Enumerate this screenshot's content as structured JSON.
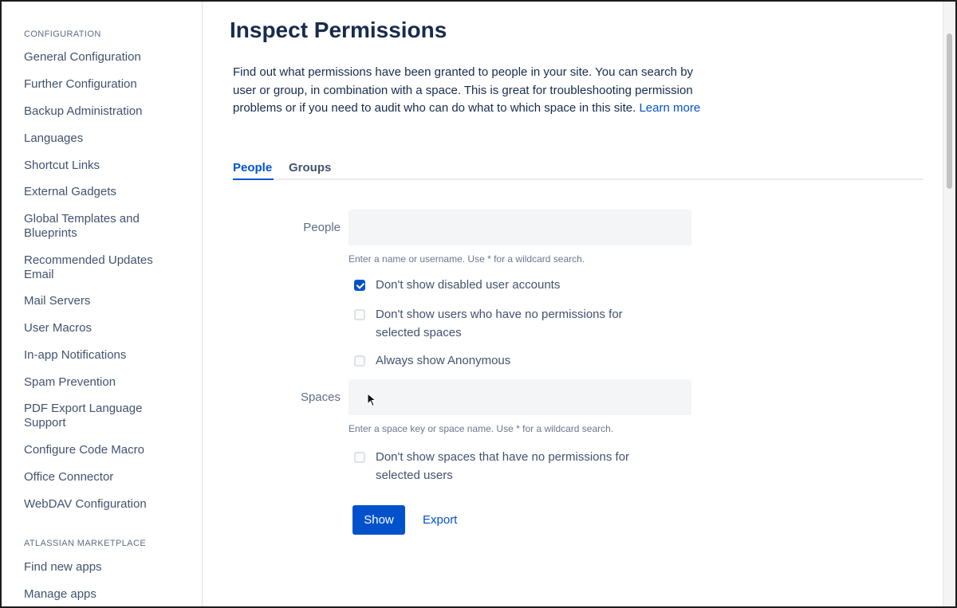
{
  "sidebar": {
    "configuration_heading": "CONFIGURATION",
    "items": [
      {
        "label": "General Configuration"
      },
      {
        "label": "Further Configuration"
      },
      {
        "label": "Backup Administration"
      },
      {
        "label": "Languages"
      },
      {
        "label": "Shortcut Links"
      },
      {
        "label": "External Gadgets"
      },
      {
        "label": "Global Templates and Blueprints"
      },
      {
        "label": "Recommended Updates Email"
      },
      {
        "label": "Mail Servers"
      },
      {
        "label": "User Macros"
      },
      {
        "label": "In-app Notifications"
      },
      {
        "label": "Spam Prevention"
      },
      {
        "label": "PDF Export Language Support"
      },
      {
        "label": "Configure Code Macro"
      },
      {
        "label": "Office Connector"
      },
      {
        "label": "WebDAV Configuration"
      }
    ],
    "marketplace_heading": "ATLASSIAN MARKETPLACE",
    "marketplace_items": [
      {
        "label": "Find new apps"
      },
      {
        "label": "Manage apps"
      }
    ]
  },
  "main": {
    "title": "Inspect Permissions",
    "intro_text": "Find out what permissions have been granted to people in your site. You can search by user or group, in combination with a space. This is great for troubleshooting permission problems or if you need to audit who can do what to which space in this site.",
    "learn_more": "Learn more",
    "tabs": [
      {
        "label": "People",
        "active": true
      },
      {
        "label": "Groups",
        "active": false
      }
    ],
    "people_field": {
      "label": "People",
      "value": "",
      "help": "Enter a name or username. Use * for a wildcard search."
    },
    "people_options": [
      {
        "label": "Don't show disabled user accounts",
        "checked": true
      },
      {
        "label": "Don't show users who have no permissions for",
        "label_line2": "selected spaces",
        "checked": false
      },
      {
        "label": "Always show Anonymous",
        "checked": false
      }
    ],
    "spaces_field": {
      "label": "Spaces",
      "value": "",
      "help": "Enter a space key or space name. Use * for a wildcard search."
    },
    "spaces_options": [
      {
        "label": "Don't show spaces that have no permissions for",
        "label_line2": "selected users",
        "checked": false
      }
    ],
    "show_button": "Show",
    "export_link": "Export"
  },
  "colors": {
    "accent": "#0052cc",
    "text": "#172b4d",
    "muted": "#5e6c84",
    "input_bg": "#f4f5f7"
  }
}
